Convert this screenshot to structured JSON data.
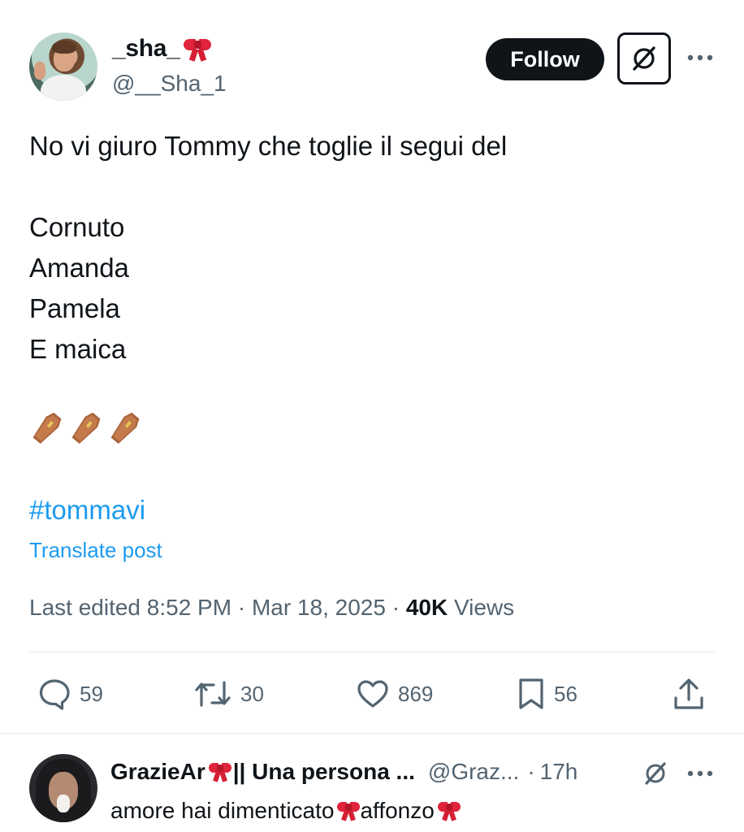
{
  "post": {
    "author": {
      "display_name": "_sha_",
      "display_name_emoji": "bow-emoji",
      "handle": "@__Sha_1"
    },
    "follow_label": "Follow",
    "grok_icon": "grok-icon",
    "more_icon": "more-dots-icon",
    "text": "No vi giuro Tommy che toglie il segui del\n\nCornuto\nAmanda\nPamela\nE maica",
    "emoji_row": [
      "coffin-emoji",
      "coffin-emoji",
      "coffin-emoji"
    ],
    "hashtag": "#tommavi",
    "translate_label": "Translate post",
    "meta": {
      "edited_prefix": "Last edited ",
      "time": "8:52 PM",
      "separator": " · ",
      "date": "Mar 18, 2025",
      "views_count": "40K",
      "views_label": " Views"
    },
    "actions": {
      "replies": "59",
      "reposts": "30",
      "likes": "869",
      "bookmarks": "56"
    }
  },
  "reply": {
    "display_name": "GrazieAr",
    "display_name_rest": "|| Una persona ...",
    "handle": "@Graz...",
    "dot": "·",
    "time": "17h",
    "text_prefix": "amore hai dimenticato ",
    "text_middle": "affonzo",
    "colors": {
      "accent": "#1d9bf0",
      "text": "#0f1419",
      "muted": "#536471",
      "bow": "#e0243b"
    }
  }
}
